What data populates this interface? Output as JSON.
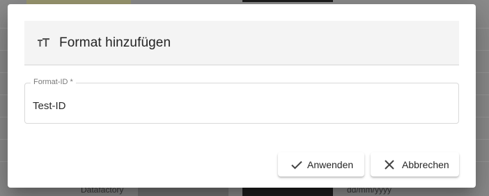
{
  "background": {
    "bottom_row": {
      "label": "Datafactory",
      "date_format": "dd/mm/yyyy"
    }
  },
  "dialog": {
    "title": "Format hinzufügen",
    "title_icon": "text-format-icon",
    "field": {
      "label": "Format-ID *",
      "value": "Test-ID"
    },
    "buttons": {
      "apply": {
        "label": "Anwenden",
        "icon": "check-icon"
      },
      "cancel": {
        "label": "Abbrechen",
        "icon": "close-icon"
      }
    }
  }
}
